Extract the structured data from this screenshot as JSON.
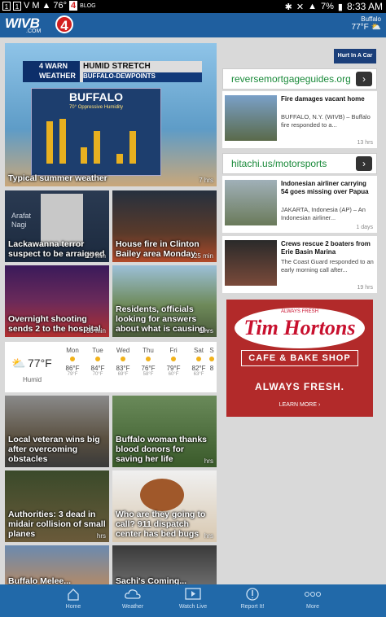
{
  "status_bar": {
    "left_icons": [
      "1",
      "1",
      "V",
      "M",
      "▲"
    ],
    "temp": "76°",
    "channel": "4",
    "channel_sub": "BLOG",
    "battery": "7%",
    "time": "8:33 AM"
  },
  "header": {
    "logo_text": "WIVB",
    "logo_sub": ".COM",
    "logo_number": "4",
    "weather_city": "Buffalo",
    "weather_temp": "77°F"
  },
  "tiles": [
    {
      "caption": "Typical summer weather",
      "age": "7 hrs",
      "banner_left": "4 WARN WEATHER",
      "banner_right": "HUMID STRETCH",
      "banner_sub": "BUFFALO-DEWPOINTS",
      "chart_title": "BUFFALO",
      "chart_sub": "70° Oppressive Humidity"
    },
    {
      "caption": "Lackawanna terror suspect to be arraigned",
      "age": "29 min",
      "overlay": "Arafat Nagi"
    },
    {
      "caption": "House fire in Clinton Bailey area Monday",
      "age": "25 min"
    },
    {
      "caption": "Overnight shooting sends 2 to the hospital",
      "age": "30 min"
    },
    {
      "caption": "Residents, officials looking for answers about what is causing...",
      "age": "8 hrs"
    },
    {
      "caption": "Local veteran wins big after overcoming obstacles",
      "age": ""
    },
    {
      "caption": "Buffalo woman thanks blood donors for saving her life",
      "age": "hrs"
    },
    {
      "caption": "Authorities: 3 dead in midair collision of small planes",
      "age": "hrs"
    },
    {
      "caption": "Who are they going to call? 911 dispatch center has bed bugs",
      "age": "hrs"
    },
    {
      "caption": "Buffalo Melee...",
      "age": ""
    },
    {
      "caption": "Sachi's Coming...",
      "age": ""
    }
  ],
  "weather_strip": {
    "current_temp": "77°F",
    "current_label": "Humid",
    "days": [
      {
        "day": "Mon",
        "hi": "86°F",
        "lo": "79°F"
      },
      {
        "day": "Tue",
        "hi": "84°F",
        "lo": "70°F"
      },
      {
        "day": "Wed",
        "hi": "83°F",
        "lo": "69°F"
      },
      {
        "day": "Thu",
        "hi": "76°F",
        "lo": "58°F"
      },
      {
        "day": "Fri",
        "hi": "79°F",
        "lo": "60°F"
      },
      {
        "day": "Sat",
        "hi": "82°F",
        "lo": "63°F"
      },
      {
        "day": "S",
        "hi": "8",
        "lo": ""
      }
    ]
  },
  "right_col": {
    "top_ad": "Hurt In A Car",
    "ad1_url": "reversemortgageguides.org",
    "news1": {
      "headline": "Fire damages vacant home",
      "summary": "BUFFALO, N.Y. (WIVB) – Buffalo fire responded to a...",
      "ago": "13 hrs"
    },
    "ad2_url": "hitachi.us/motorsports",
    "news2": {
      "headline": "Indonesian airliner carrying 54 goes missing over Papua",
      "summary": "JAKARTA, Indonesia (AP) – An Indonesian airliner...",
      "ago": "1 days"
    },
    "news3": {
      "headline": "Crews rescue 2 boaters from Erie Basin Marina",
      "summary": "The Coast Guard responded to an early morning call after...",
      "ago": "19 hrs"
    }
  },
  "tims_ad": {
    "since": "ALWAYS FRESH",
    "brand": "Tim Hortons",
    "cafe": "CAFE & BAKE SHOP",
    "tagline": "ALWAYS FRESH.",
    "cta": "LEARN MORE ›"
  },
  "bottom_nav": [
    {
      "label": "Home",
      "icon": "home-icon"
    },
    {
      "label": "Weather",
      "icon": "cloud-icon"
    },
    {
      "label": "Watch Live",
      "icon": "play-icon"
    },
    {
      "label": "Report It!",
      "icon": "report-icon"
    },
    {
      "label": "More",
      "icon": "more-icon"
    }
  ]
}
